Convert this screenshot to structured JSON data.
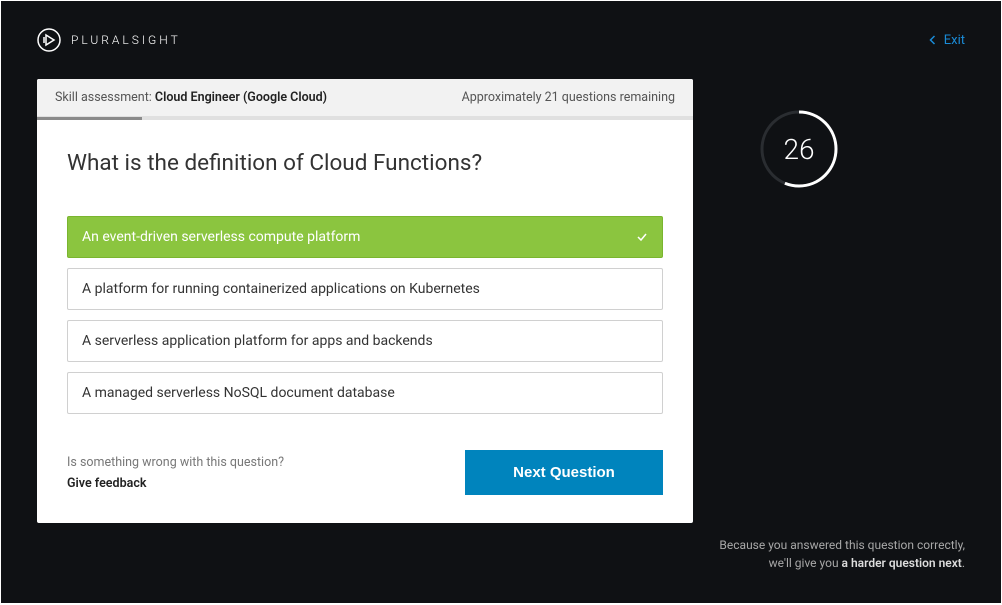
{
  "header": {
    "brand": "PLURALSIGHT",
    "exit_label": "Exit"
  },
  "assessment": {
    "label_prefix": "Skill assessment: ",
    "name": "Cloud Engineer (Google Cloud)",
    "remaining_text": "Approximately 21 questions remaining"
  },
  "question": {
    "text": "What is the definition of Cloud Functions?"
  },
  "options": [
    {
      "text": "An event-driven serverless compute platform",
      "selected": true
    },
    {
      "text": "A platform for running containerized applications on Kubernetes",
      "selected": false
    },
    {
      "text": "A serverless application platform for apps and backends",
      "selected": false
    },
    {
      "text": "A managed serverless NoSQL document database",
      "selected": false
    }
  ],
  "feedback": {
    "prompt": "Is something wrong with this question?",
    "link": "Give feedback"
  },
  "next_button": "Next Question",
  "timer": {
    "value": "26",
    "progress_percent": 56
  },
  "result_message": {
    "line1": "Because you answered this question correctly,",
    "line2_prefix": "we'll give you ",
    "line2_bold": "a harder question next",
    "line2_suffix": "."
  }
}
